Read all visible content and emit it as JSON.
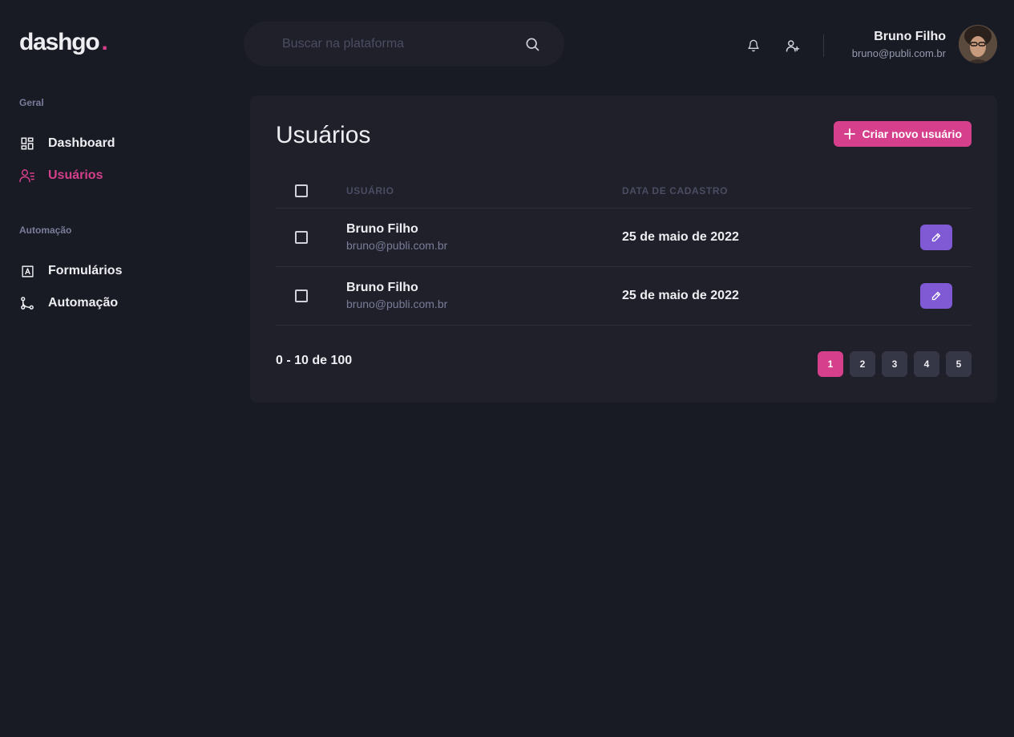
{
  "brand": {
    "name": "dashgo",
    "dot": "."
  },
  "search": {
    "placeholder": "Buscar na plataforma",
    "icon": "search-icon"
  },
  "header": {
    "icons": [
      "bell-icon",
      "user-add-icon"
    ]
  },
  "profile": {
    "name": "Bruno Filho",
    "email": "bruno@publi.com.br"
  },
  "sidebar": {
    "sections": [
      {
        "title": "Geral",
        "items": [
          {
            "label": "Dashboard",
            "icon": "dashboard-icon",
            "active": false
          },
          {
            "label": "Usuários",
            "icon": "users-icon",
            "active": true
          }
        ]
      },
      {
        "title": "Automação",
        "items": [
          {
            "label": "Formulários",
            "icon": "form-icon",
            "active": false
          },
          {
            "label": "Automação",
            "icon": "git-merge-icon",
            "active": false
          }
        ]
      }
    ]
  },
  "main": {
    "title": "Usuários",
    "create_button": "Criar novo usuário",
    "table": {
      "columns": [
        "Usuário",
        "Data de cadastro"
      ],
      "rows": [
        {
          "name": "Bruno Filho",
          "email": "bruno@publi.com.br",
          "date": "25 de maio de 2022"
        },
        {
          "name": "Bruno Filho",
          "email": "bruno@publi.com.br",
          "date": "25 de maio de 2022"
        }
      ]
    },
    "pagination": {
      "info": "0 - 10 de 100",
      "pages": [
        "1",
        "2",
        "3",
        "4",
        "5"
      ],
      "current": "1"
    }
  },
  "colors": {
    "accent": "#d53f8c",
    "edit": "#805ad5",
    "background": "#181b23",
    "card": "#1f2029"
  }
}
